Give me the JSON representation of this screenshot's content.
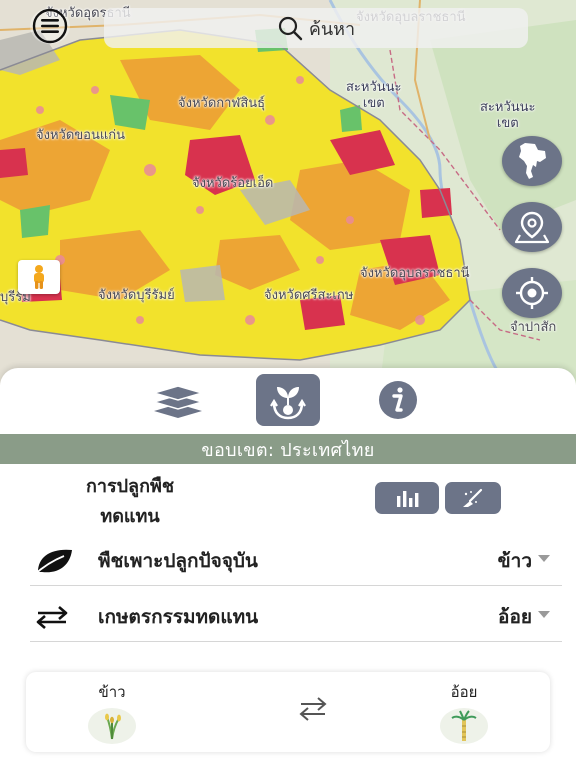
{
  "search": {
    "placeholder": "ค้นหา"
  },
  "map": {
    "labels": {
      "udon": "จังหวัดอุดรธานี",
      "kalasin": "จังหวัดกาฬสินธุ์",
      "khonkaen": "จังหวัดขอนแก่น",
      "roiet": "จังหวัดร้อยเอ็ด",
      "mukdahan": "จังหวัดมุกดาหาร",
      "ubon": "จังหวัดอุบลราชธานี",
      "surin": "จังหวัดบุรีรัมย์",
      "sisaket": "จังหวัดศรีสะเกษ",
      "buriram_left": "บุรีรัม",
      "lao_east_1a": "สะหวันนะ",
      "lao_east_1b": "เขต",
      "lao_east_2a": "สะหวันนะ",
      "lao_east_2b": "เขต",
      "champasak": "จำปาสัก"
    }
  },
  "toolbar": {
    "layers": "layers-icon",
    "substitution": "plant-substitution-icon",
    "info": "info-icon"
  },
  "scope": {
    "label": "ขอบเขต: ประเทศไทย"
  },
  "substitution": {
    "title": "การปลูกพืชทดแทน",
    "chart_button": "bar-chart-icon",
    "clear_button": "broom-icon"
  },
  "current_crop": {
    "label": "พืชเพาะปลูกปัจจุบัน",
    "value": "ข้าว"
  },
  "alternative": {
    "label": "เกษตรกรรมทดแทน",
    "value": "อ้อย"
  },
  "compare": {
    "from": "ข้าว",
    "to": "อ้อย"
  },
  "colors": {
    "accent": "#6c7488",
    "scope_bar": "#8a9c88",
    "map_yellow": "#f2e22c",
    "map_orange": "#eda534",
    "map_red": "#d8324e",
    "map_green": "#68c26a"
  }
}
